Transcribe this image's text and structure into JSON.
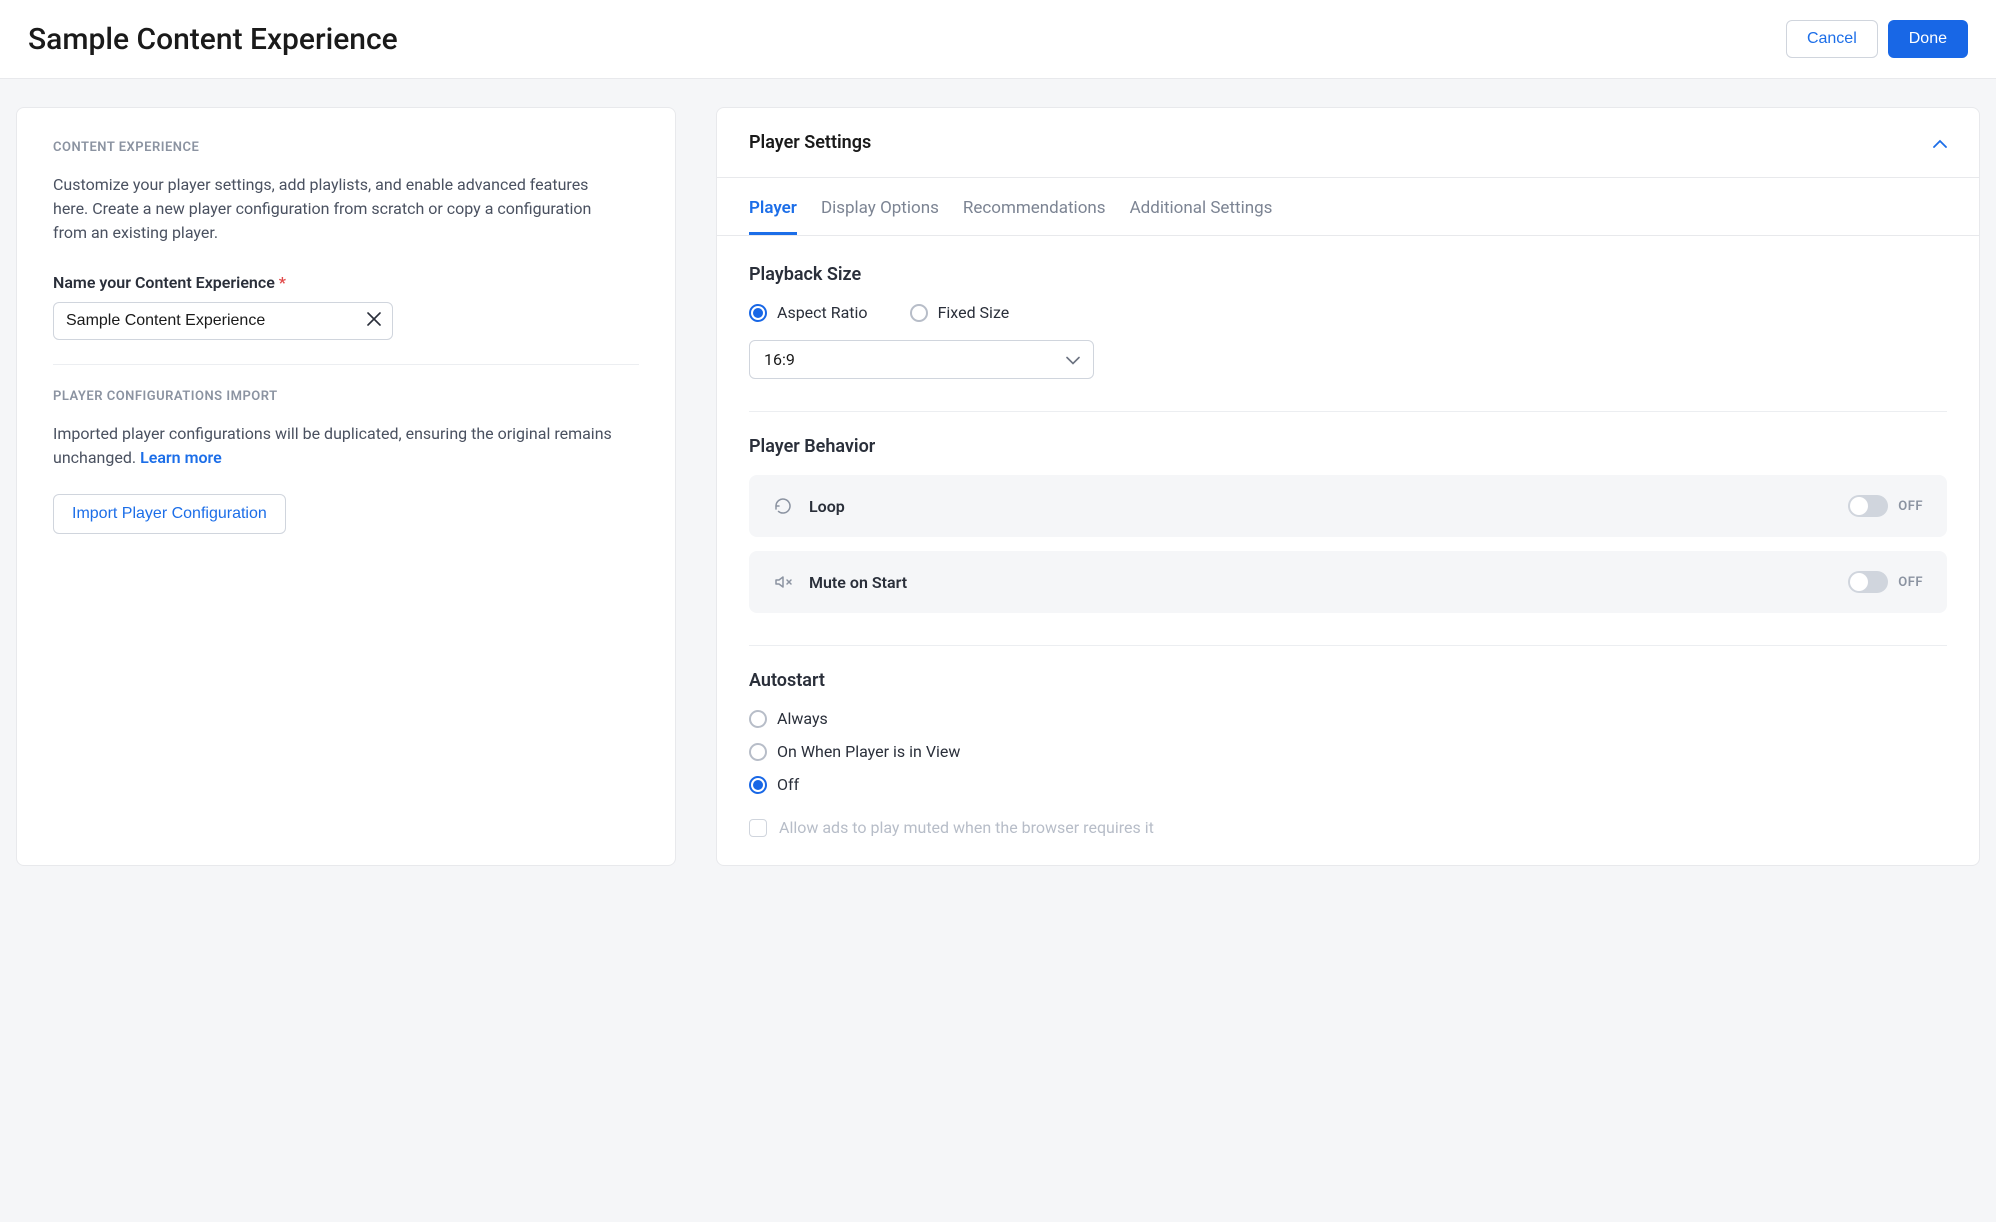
{
  "header": {
    "title": "Sample Content Experience",
    "cancel": "Cancel",
    "done": "Done"
  },
  "contentExperience": {
    "sectionLabel": "CONTENT EXPERIENCE",
    "description": "Customize your player settings, add playlists, and enable advanced features here. Create a new player configuration from scratch or copy a configuration from an existing player.",
    "nameLabel": "Name your Content Experience",
    "nameValue": "Sample Content Experience"
  },
  "configImport": {
    "sectionLabel": "PLAYER CONFIGURATIONS IMPORT",
    "description": "Imported player configurations will be duplicated, ensuring the original remains unchanged. ",
    "learnMore": "Learn more",
    "button": "Import Player Configuration"
  },
  "playerSettings": {
    "title": "Player Settings",
    "tabs": {
      "player": "Player",
      "displayOptions": "Display Options",
      "recommendations": "Recommendations",
      "additional": "Additional Settings"
    },
    "playbackSize": {
      "title": "Playback Size",
      "aspectRatio": "Aspect Ratio",
      "fixedSize": "Fixed Size",
      "selected": "16:9"
    },
    "playerBehavior": {
      "title": "Player Behavior",
      "loop": "Loop",
      "mute": "Mute on Start",
      "off": "OFF"
    },
    "autostart": {
      "title": "Autostart",
      "always": "Always",
      "onView": "On When Player is in View",
      "off": "Off",
      "allowAds": "Allow ads to play muted when the browser requires it"
    }
  }
}
